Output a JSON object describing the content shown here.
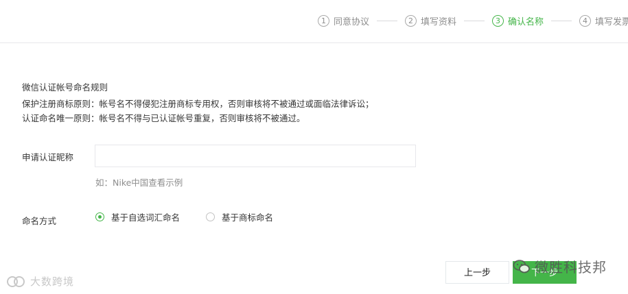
{
  "steps": [
    {
      "num": "1",
      "label": "同意协议",
      "active": false
    },
    {
      "num": "2",
      "label": "填写资料",
      "active": false
    },
    {
      "num": "3",
      "label": "确认名称",
      "active": true
    },
    {
      "num": "4",
      "label": "填写发票",
      "active": false
    }
  ],
  "rules": {
    "title": "微信认证帐号命名规则",
    "line1": "保护注册商标原则：帐号名不得侵犯注册商标专用权，否则审核将不被通过或面临法律诉讼；",
    "line2": "认证命名唯一原则：帐号名不得与已认证帐号重复，否则审核将不被通过。"
  },
  "form": {
    "nickname_label": "申请认证昵称",
    "nickname_value": "",
    "nickname_placeholder": "",
    "hint": "如：Nike中国查看示例",
    "method_label": "命名方式",
    "options": [
      {
        "label": "基于自选词汇命名",
        "checked": true
      },
      {
        "label": "基于商标命名",
        "checked": false
      }
    ]
  },
  "buttons": {
    "prev": "上一步",
    "next": "下一步"
  },
  "watermarks": {
    "left": "大数跨境",
    "right": "微胜科技邦"
  },
  "colors": {
    "accent": "#44b549",
    "muted": "#8d8d8d",
    "border": "#e7e7eb"
  }
}
